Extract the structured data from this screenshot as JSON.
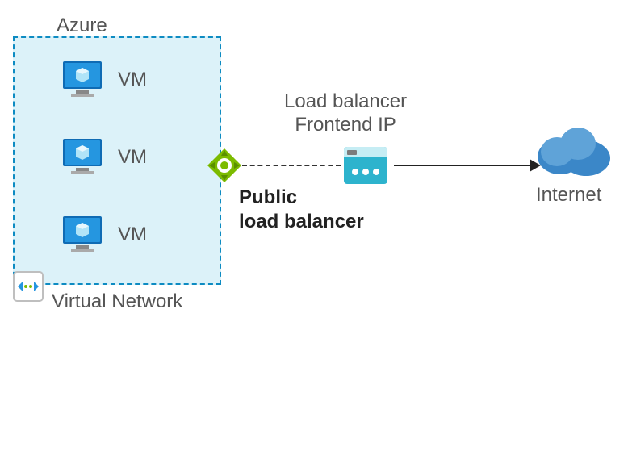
{
  "azure": {
    "label": "Azure"
  },
  "vnet": {
    "label": "Virtual Network",
    "vms": [
      {
        "label": "VM"
      },
      {
        "label": "VM"
      },
      {
        "label": "VM"
      }
    ]
  },
  "load_balancer": {
    "title_line1": "Public",
    "title_line2": "load balancer"
  },
  "frontend": {
    "line1": "Load balancer",
    "line2": "Frontend IP"
  },
  "internet": {
    "label": "Internet"
  },
  "colors": {
    "azure_blue": "#0078d4",
    "vnet_bg": "#dcf2f9",
    "vnet_border": "#0d8bc2",
    "lb_green": "#7cbb00",
    "cloud_blue": "#3b87c8",
    "frontend_cyan": "#2db3cd"
  }
}
